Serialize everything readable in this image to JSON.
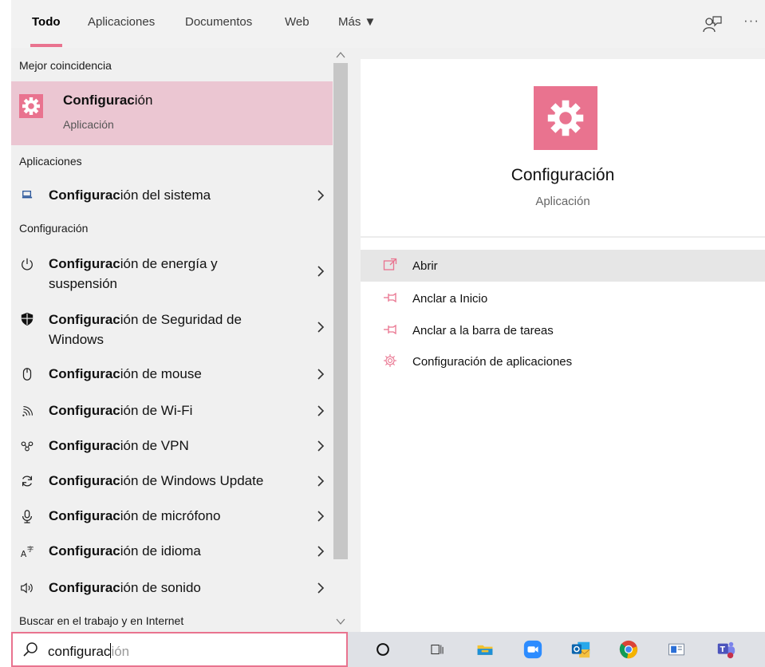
{
  "tabs": [
    {
      "label": "Todo",
      "active": true
    },
    {
      "label": "Aplicaciones",
      "active": false
    },
    {
      "label": "Documentos",
      "active": false
    },
    {
      "label": "Web",
      "active": false
    },
    {
      "label": "Más ▼",
      "active": false
    }
  ],
  "header_icons": {
    "feedback": "feedback-icon",
    "more": "···"
  },
  "best_match": {
    "section_label": "Mejor coincidencia",
    "title_bold": "Configurac",
    "title_rest": "ión",
    "subtitle": "Aplicación",
    "icon": "gear-icon"
  },
  "apps_section": {
    "label": "Aplicaciones",
    "items": [
      {
        "bold": "Configurac",
        "rest": "ión del sistema",
        "icon": "laptop-icon"
      }
    ]
  },
  "settings_section": {
    "label": "Configuración",
    "items": [
      {
        "bold": "Configurac",
        "rest": "ión de energía y suspensión",
        "icon": "power-icon"
      },
      {
        "bold": "Configurac",
        "rest": "ión de Seguridad de Windows",
        "icon": "shield-icon"
      },
      {
        "bold": "Configurac",
        "rest": "ión de mouse",
        "icon": "mouse-icon"
      },
      {
        "bold": "Configurac",
        "rest": "ión de Wi-Fi",
        "icon": "wifi-icon"
      },
      {
        "bold": "Configurac",
        "rest": "ión de VPN",
        "icon": "vpn-icon"
      },
      {
        "bold": "Configurac",
        "rest": "ión de Windows Update",
        "icon": "refresh-icon"
      },
      {
        "bold": "Configurac",
        "rest": "ión de micrófono",
        "icon": "microphone-icon"
      },
      {
        "bold": "Configurac",
        "rest": "ión de idioma",
        "icon": "language-icon"
      },
      {
        "bold": "Configurac",
        "rest": "ión de sonido",
        "icon": "speaker-icon"
      }
    ]
  },
  "web_section": {
    "label": "Buscar en el trabajo y en Internet"
  },
  "details": {
    "title": "Configuración",
    "subtitle": "Aplicación",
    "actions": [
      {
        "label": "Abrir",
        "icon": "open-icon"
      },
      {
        "label": "Anclar a Inicio",
        "icon": "pin-icon"
      },
      {
        "label": "Anclar a la barra de tareas",
        "icon": "pin-icon"
      },
      {
        "label": "Configuración de aplicaciones",
        "icon": "gear-outline-icon"
      }
    ]
  },
  "search": {
    "typed": "configurac",
    "suggestion": "ión",
    "icon": "search-icon"
  },
  "taskbar": {
    "items": [
      "cortana-icon",
      "task-view-icon",
      "file-explorer-icon",
      "zoom-icon",
      "outlook-icon",
      "chrome-icon",
      "app-icon",
      "teams-icon"
    ]
  },
  "colors": {
    "accent": "#e9738f",
    "selection": "#ebc6d2",
    "pane": "#f0f0f0"
  }
}
